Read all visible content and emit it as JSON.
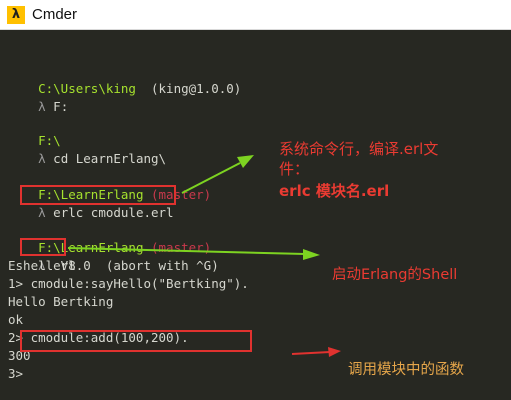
{
  "window": {
    "title": "Cmder",
    "icon_glyph": "λ"
  },
  "terminal": {
    "line1": {
      "path": "C:\\Users\\king",
      "info": "  (king@1.0.0)"
    },
    "line2": {
      "prompt": "λ",
      "cmd": " F:"
    },
    "line3": {
      "path": "F:\\"
    },
    "line4": {
      "prompt": "λ",
      "cmd": " cd LearnErlang\\"
    },
    "line5": {
      "path": "F:\\LearnErlang",
      "branch": " (master)"
    },
    "line6": {
      "prompt": "λ",
      "cmd": " erlc cmodule.erl"
    },
    "line7": {
      "path": "F:\\LearnErlang",
      "branch": " (master)"
    },
    "line8": {
      "prompt": "λ",
      "cmd": " erl"
    },
    "line9": "Eshell V8.0  (abort with ^G)",
    "line10": "1> cmodule:sayHello(\"Bertking\").",
    "line11": "Hello Bertking",
    "line12": "ok",
    "line13": "2> cmodule:add(100,200).",
    "line14": "300",
    "line15": "3>"
  },
  "annotations": {
    "compile_line1": "系统命令行，编译.erl文",
    "compile_line2": "件：",
    "compile_line3": "erlc 模块名.erl",
    "shell": "启动Erlang的Shell",
    "call": "调用模块中的函数"
  },
  "colors": {
    "background": "#272822",
    "path": "#a6e22e",
    "branch": "#c9394c",
    "annotation_red": "#ea3b32",
    "arrow_green": "#7dd321",
    "arrow_red": "#e0322f"
  }
}
